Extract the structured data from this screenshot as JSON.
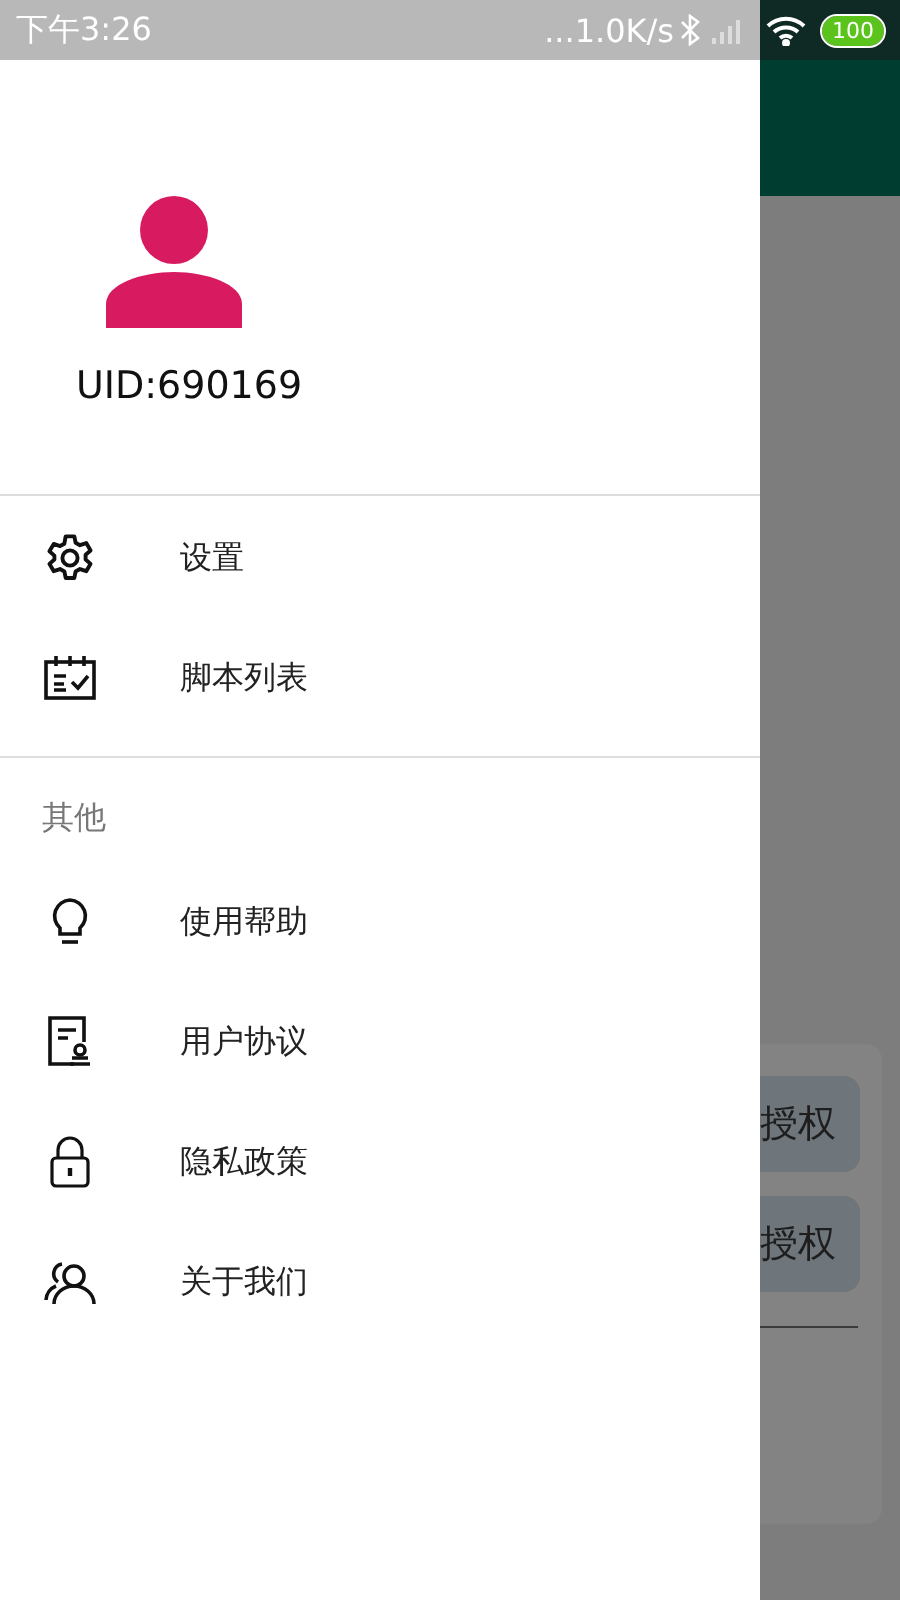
{
  "status_bar": {
    "time": "下午3:26",
    "speed": "...1.0K/s",
    "battery": "100"
  },
  "drawer": {
    "uid": "UID:690169",
    "main_items": [
      {
        "label": "设置"
      },
      {
        "label": "脚本列表"
      }
    ],
    "section_title": "其他",
    "other_items": [
      {
        "label": "使用帮助"
      },
      {
        "label": "用户协议"
      },
      {
        "label": "隐私政策"
      },
      {
        "label": "关于我们"
      }
    ]
  },
  "background_app": {
    "buttons": [
      "授权",
      "授权"
    ]
  }
}
